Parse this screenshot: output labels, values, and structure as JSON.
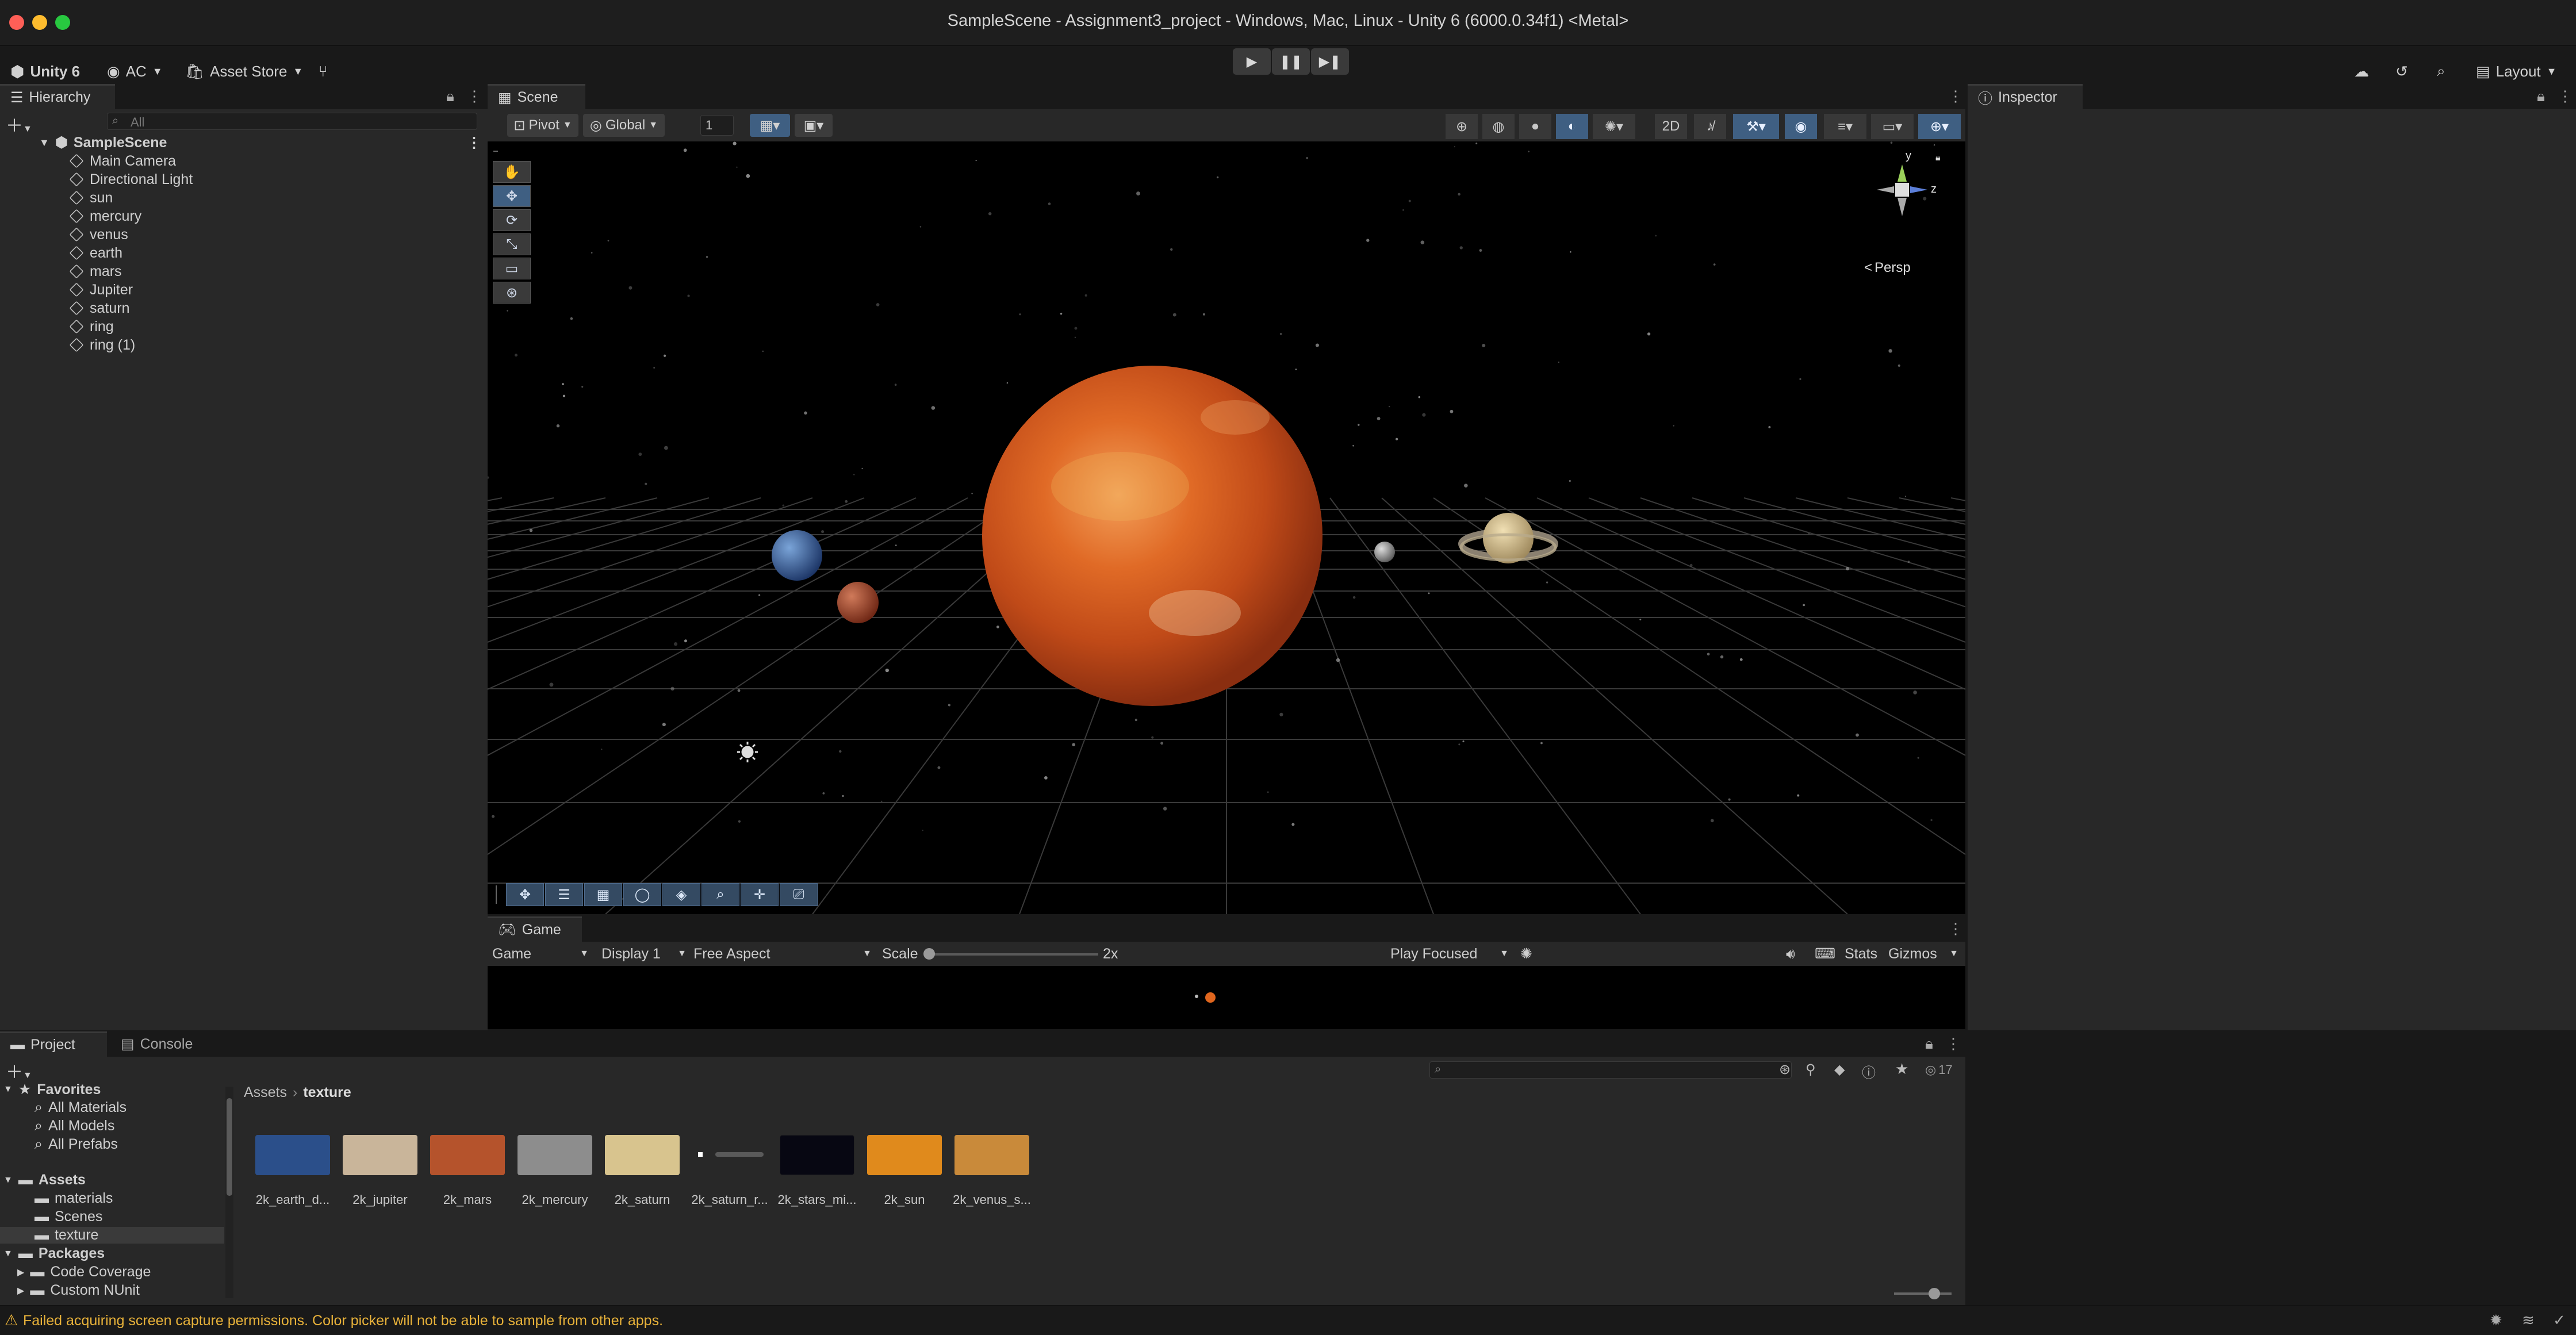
{
  "window": {
    "title": "SampleScene - Assignment3_project - Windows, Mac, Linux - Unity 6 (6000.0.34f1) <Metal>"
  },
  "toolbar": {
    "unity_label": "Unity 6",
    "account_label": "AC",
    "asset_store_label": "Asset Store",
    "layout_label": "Layout"
  },
  "hierarchy": {
    "tab_label": "Hierarchy",
    "search_placeholder": "All",
    "scene_name": "SampleScene",
    "items": [
      {
        "label": "Main Camera"
      },
      {
        "label": "Directional Light"
      },
      {
        "label": "sun"
      },
      {
        "label": "mercury"
      },
      {
        "label": "venus"
      },
      {
        "label": "earth"
      },
      {
        "label": "mars"
      },
      {
        "label": "Jupiter"
      },
      {
        "label": "saturn"
      },
      {
        "label": "ring"
      },
      {
        "label": "ring (1)"
      }
    ]
  },
  "scene": {
    "tab_label": "Scene",
    "pivot_label": "Pivot",
    "global_label": "Global",
    "grid_snap_value": "1",
    "persp_label": "Persp",
    "gizmo_axes": {
      "y": "y",
      "z": "z"
    }
  },
  "game": {
    "tab_label": "Game",
    "mode": "Game",
    "display": "Display 1",
    "aspect": "Free Aspect",
    "scale_label": "Scale",
    "scale_value": "2x",
    "scale_fraction": 0.0,
    "play_mode": "Play Focused",
    "stats_label": "Stats",
    "gizmos_label": "Gizmos"
  },
  "inspector": {
    "tab_label": "Inspector"
  },
  "project": {
    "tab_label": "Project",
    "console_tab_label": "Console",
    "hidden_count": "17",
    "breadcrumb": [
      "Assets",
      "texture"
    ],
    "favorites": {
      "label": "Favorites",
      "items": [
        "All Materials",
        "All Models",
        "All Prefabs"
      ]
    },
    "assets": {
      "label": "Assets",
      "items": [
        "materials",
        "Scenes",
        "texture"
      ]
    },
    "packages": {
      "label": "Packages",
      "items": [
        "Code Coverage",
        "Custom NUnit"
      ]
    },
    "files": [
      {
        "label": "2k_earth_d...",
        "color": "#2b4f8a"
      },
      {
        "label": "2k_jupiter",
        "color": "#c9b59a"
      },
      {
        "label": "2k_mars",
        "color": "#b5532c"
      },
      {
        "label": "2k_mercury",
        "color": "#8d8d8d"
      },
      {
        "label": "2k_saturn",
        "color": "#d8c48e"
      },
      {
        "label": "2k_saturn_r...",
        "color": "#5a5a5a"
      },
      {
        "label": "2k_stars_mi...",
        "color": "#070712"
      },
      {
        "label": "2k_sun",
        "color": "#e08a1c"
      },
      {
        "label": "2k_venus_s...",
        "color": "#c98a3a"
      }
    ]
  },
  "status": {
    "message": "Failed acquiring screen capture permissions. Color picker will not be able to sample from other apps."
  },
  "colors": {
    "accent": "#3f5f82",
    "warning": "#e8b23a"
  }
}
